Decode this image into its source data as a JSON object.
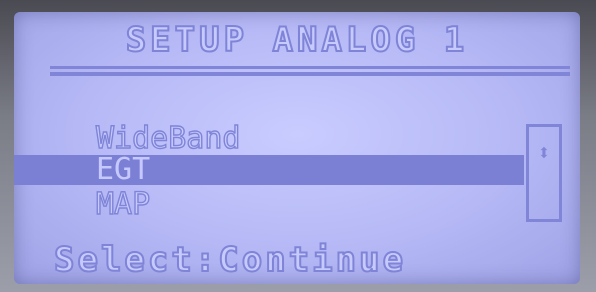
{
  "screen": {
    "title": "SETUP ANALOG 1",
    "menu": {
      "items": [
        {
          "label": "WideBand",
          "selected": false
        },
        {
          "label": "EGT",
          "selected": true
        },
        {
          "label": "MAP",
          "selected": false
        }
      ],
      "scroll_indicator": "⬍"
    },
    "footer_hint": "Select:Continue"
  },
  "colors": {
    "lcd_background": "#b9bcf7",
    "lcd_pixel": "#8185d8",
    "highlight_bar": "#7c80d4"
  },
  "icons": {
    "scroll": "up-down-arrow-icon"
  }
}
